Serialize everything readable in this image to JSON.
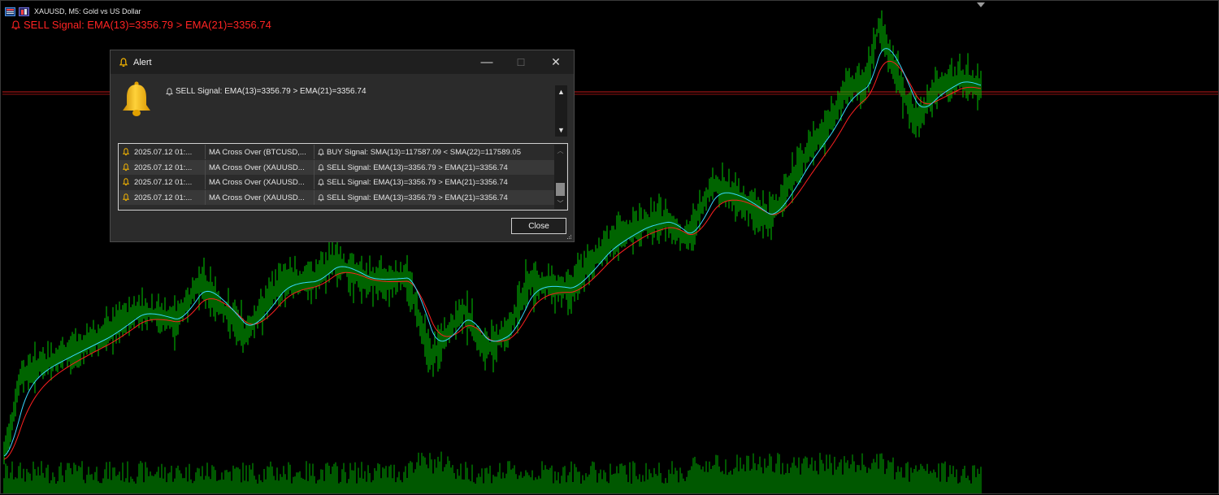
{
  "header": {
    "symbol_text": "XAUUSD, M5:  Gold vs US Dollar",
    "signal_text": "SELL Signal: EMA(13)=3356.79 > EMA(21)=3356.74"
  },
  "alert": {
    "title": "Alert",
    "message": "SELL Signal: EMA(13)=3356.79 > EMA(21)=3356.74",
    "rows": [
      {
        "time": "2025.07.12 01:...",
        "expert": "MA Cross Over (BTCUSD,...",
        "text": "BUY Signal: SMA(13)=117587.09 < SMA(22)=117589.05"
      },
      {
        "time": "2025.07.12 01:...",
        "expert": "MA Cross Over (XAUUSD...",
        "text": "SELL Signal: EMA(13)=3356.79 > EMA(21)=3356.74"
      },
      {
        "time": "2025.07.12 01:...",
        "expert": "MA Cross Over (XAUUSD...",
        "text": "SELL Signal: EMA(13)=3356.79 > EMA(21)=3356.74"
      },
      {
        "time": "2025.07.12 01:...",
        "expert": "MA Cross Over (XAUUSD...",
        "text": "SELL Signal: EMA(13)=3356.79 > EMA(21)=3356.74"
      }
    ],
    "close_label": "Close",
    "minimize_glyph": "—",
    "maximize_glyph": "☐",
    "close_glyph": "✕"
  },
  "colors": {
    "candles": "#00c800",
    "volume": "#00b000",
    "ema_fast": "#38d8ff",
    "ema_slow": "#ff2020",
    "signal_text": "#ff2323",
    "bell_gold": "#f4b400"
  },
  "icons": [
    "chart-icon",
    "symbol-icon",
    "bell-icon",
    "minimize-icon",
    "maximize-icon",
    "close-icon",
    "scroll-up-icon",
    "scroll-down-icon"
  ]
}
